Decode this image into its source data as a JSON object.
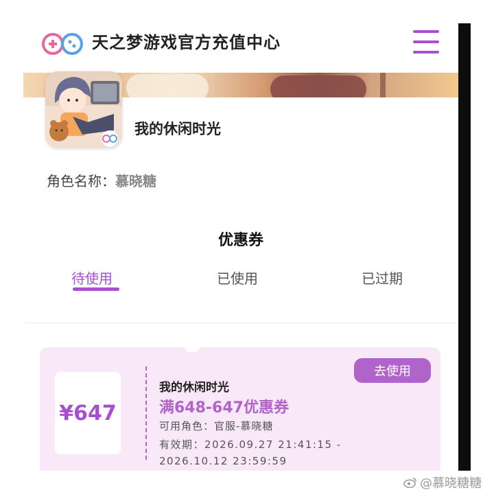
{
  "header": {
    "title": "天之梦游戏官方充值中心",
    "logo_icon": "gamepad-logo-icon",
    "menu_icon": "hamburger-menu-icon"
  },
  "game": {
    "name": "我的休闲时光",
    "role_label": "角色名称：",
    "role_value": "慕晓糖"
  },
  "coupons_section": {
    "title": "优惠券",
    "tabs": [
      {
        "label": "待使用",
        "active": true
      },
      {
        "label": "已使用",
        "active": false
      },
      {
        "label": "已过期",
        "active": false
      }
    ]
  },
  "coupon": {
    "amount": "¥647",
    "game_name": "我的休闲时光",
    "title": "满648-647优惠券",
    "role": "可用角色：官服-慕晓糖",
    "validity_line1": "有效期：2026.09.27 21:41:15 -",
    "validity_line2": "2026.10.12 23:59:59",
    "use_button": "去使用"
  },
  "watermark": "@慕晓糖糖",
  "colors": {
    "accent": "#a84fcf",
    "coupon_bg": "#f8e8f8"
  }
}
